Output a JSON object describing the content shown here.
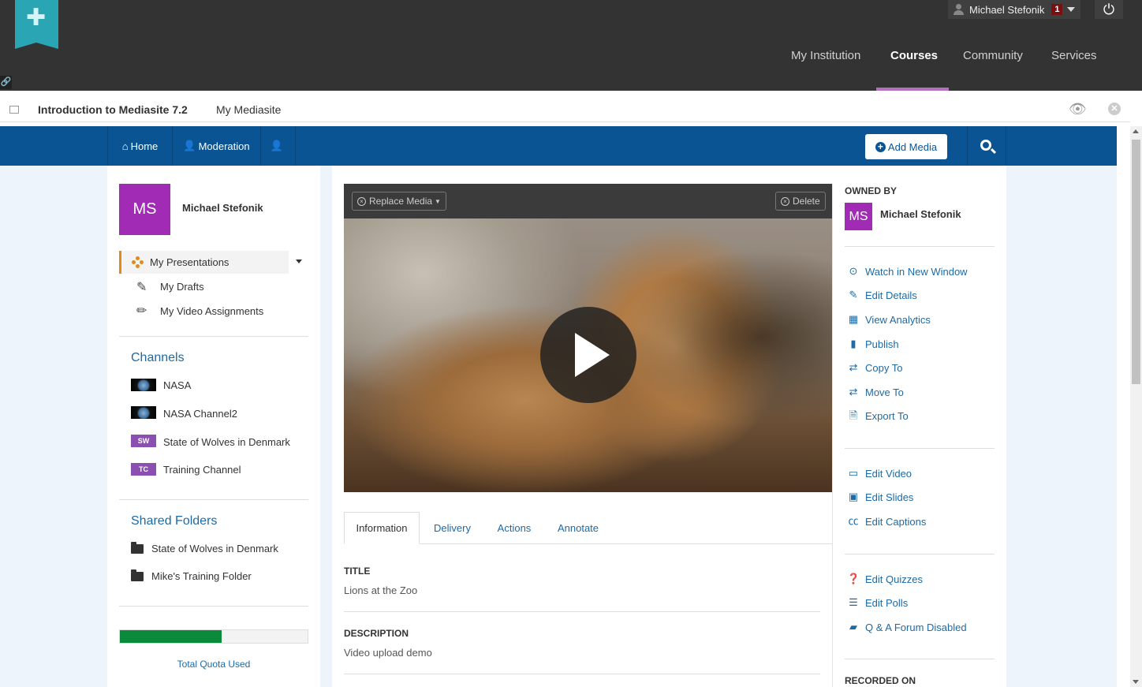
{
  "lms": {
    "user_name": "Michael Stefonik",
    "notification_count": "1",
    "nav": [
      "My Institution",
      "Courses",
      "Community",
      "Services"
    ],
    "active_nav": "Courses",
    "accent_color": "#b46fbf"
  },
  "course": {
    "title": "Introduction to Mediasite 7.2",
    "breadcrumb": "My Mediasite"
  },
  "mediasite_nav": {
    "home": "Home",
    "moderation": "Moderation",
    "add_media": "Add Media",
    "brand_color": "#0a5494"
  },
  "profile": {
    "initials": "MS",
    "name": "Michael Stefonik",
    "avatar_color": "#a12bb4"
  },
  "menu": {
    "my_presentations": "My Presentations",
    "my_drafts": "My Drafts",
    "my_video_assignments": "My Video Assignments"
  },
  "channels": {
    "heading": "Channels",
    "items": [
      {
        "label": "NASA",
        "thumb": ""
      },
      {
        "label": "NASA Channel2",
        "thumb": ""
      },
      {
        "label": "State of Wolves in Denmark",
        "thumb": "SW"
      },
      {
        "label": "Training Channel",
        "thumb": "TC"
      }
    ]
  },
  "shared_folders": {
    "heading": "Shared Folders",
    "items": [
      "State of Wolves in Denmark",
      "Mike's Training Folder"
    ]
  },
  "quota": {
    "label": "Total Quota Used",
    "fraction_used": 0.54,
    "color": "#0c8a3b"
  },
  "player": {
    "replace_media": "Replace Media",
    "delete": "Delete"
  },
  "tabs": [
    "Information",
    "Delivery",
    "Actions",
    "Annotate"
  ],
  "active_tab": "Information",
  "info": {
    "title_label": "TITLE",
    "title_value": "Lions at the Zoo",
    "description_label": "DESCRIPTION",
    "description_value": "Video upload demo"
  },
  "owner": {
    "label": "OWNED BY",
    "initials": "MS",
    "name": "Michael Stefonik"
  },
  "actions": {
    "group1": [
      "Watch in New Window",
      "Edit Details",
      "View Analytics",
      "Publish",
      "Copy To",
      "Move To",
      "Export To"
    ],
    "group2": [
      "Edit Video",
      "Edit Slides",
      "Edit Captions"
    ],
    "group3": [
      "Edit Quizzes",
      "Edit Polls",
      "Q & A Forum Disabled"
    ]
  },
  "recorded_on_label": "RECORDED ON"
}
